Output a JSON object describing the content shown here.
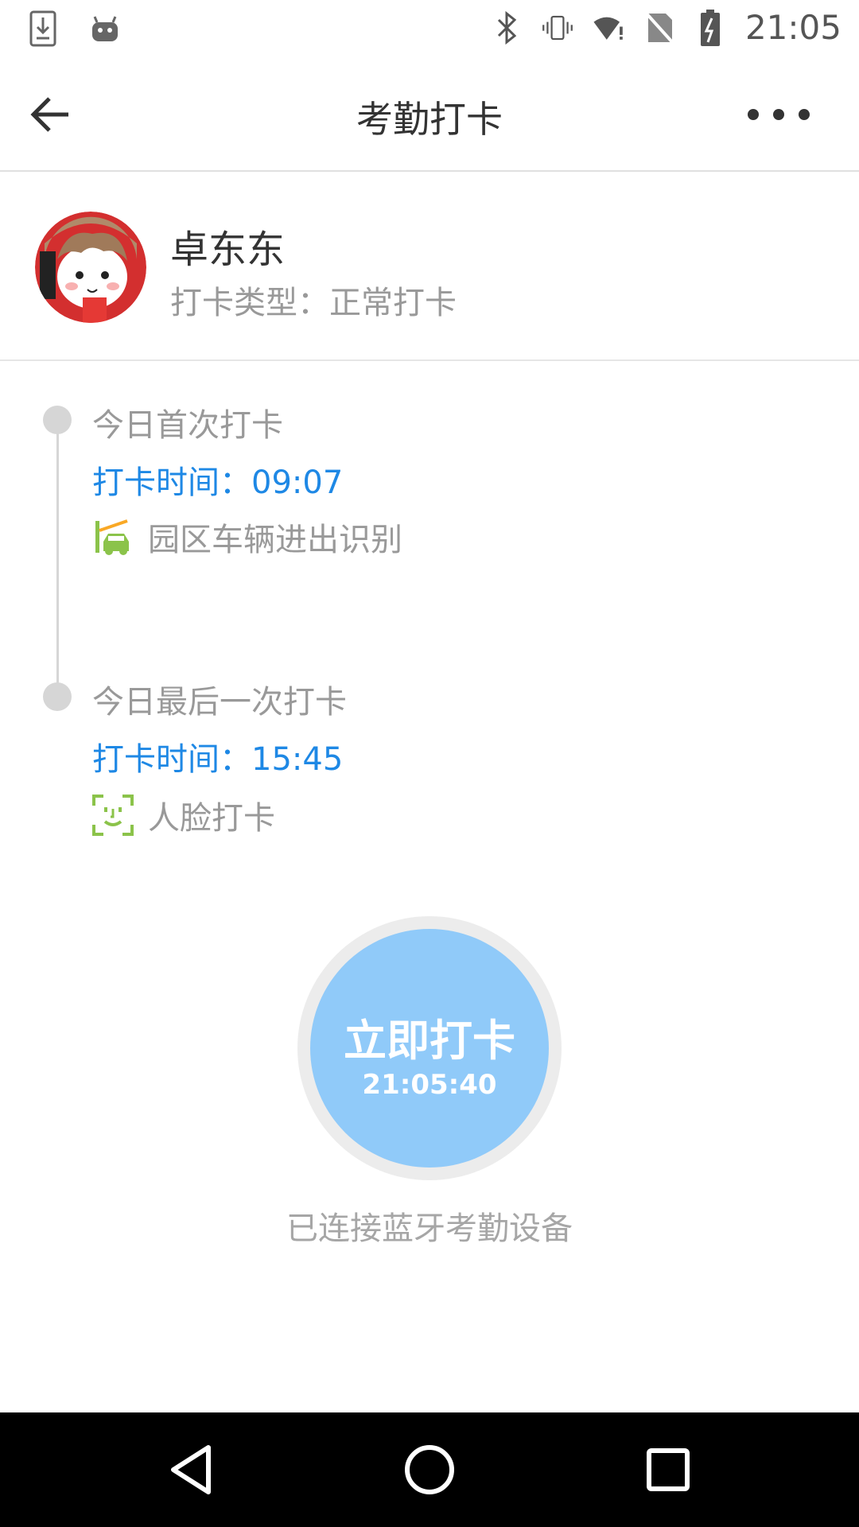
{
  "status_bar": {
    "time": "21:05",
    "icons": [
      "download-icon",
      "android-icon",
      "bluetooth-icon",
      "vibrate-icon",
      "wifi-alert-icon",
      "no-sim-icon",
      "battery-charging-icon"
    ]
  },
  "app_bar": {
    "title": "考勤打卡",
    "back_icon": "arrow-left-icon",
    "more_icon": "more-horizontal-icon"
  },
  "profile": {
    "name": "卓东东",
    "checkin_type": "打卡类型：正常打卡"
  },
  "timeline": [
    {
      "title": "今日首次打卡",
      "time": "打卡时间：09:07",
      "method": "园区车辆进出识别",
      "method_icon": "car-gate-icon"
    },
    {
      "title": "今日最后一次打卡",
      "time": "打卡时间：15:45",
      "method": "人脸打卡",
      "method_icon": "face-scan-icon"
    }
  ],
  "punch": {
    "label": "立即打卡",
    "clock": "21:05:40"
  },
  "bluetooth_status": "已连接蓝牙考勤设备",
  "colors": {
    "accent_blue": "#1e88e5",
    "button_blue": "#90caf9",
    "muted_gray": "#999999",
    "timeline_gray": "#d6d6d6",
    "icon_green": "#8bc34a"
  }
}
